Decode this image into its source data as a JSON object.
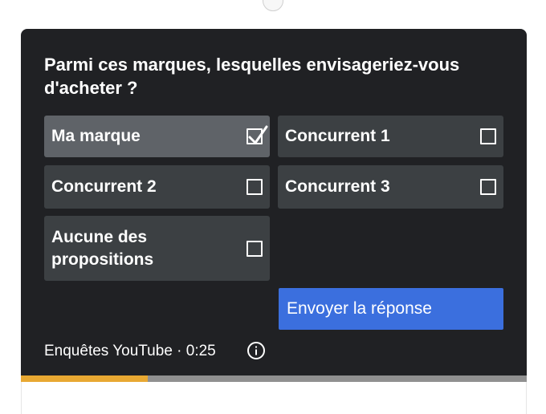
{
  "survey": {
    "question": "Parmi ces marques, lesquelles envisageriez-vous d'acheter ?",
    "options": [
      {
        "label": "Ma marque",
        "checked": true
      },
      {
        "label": "Concurrent 1",
        "checked": false
      },
      {
        "label": "Concurrent 2",
        "checked": false
      },
      {
        "label": "Concurrent 3",
        "checked": false
      },
      {
        "label": "Aucune des propositions",
        "checked": false
      }
    ],
    "submit_label": "Envoyer la réponse",
    "footer": "Enquêtes YouTube · 0:25",
    "info_icon": "info-icon",
    "progress_fraction": 0.25
  },
  "colors": {
    "card_background": "#202124",
    "option_background": "#3c4043",
    "option_selected_background": "#5f6368",
    "submit_background": "#3b6fde",
    "progress_fill": "#e8a832",
    "progress_track": "#909090"
  }
}
